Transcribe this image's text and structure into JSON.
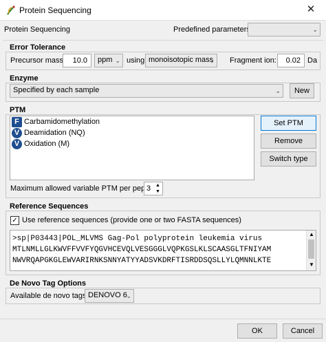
{
  "window": {
    "title": "Protein Sequencing",
    "close_glyph": "✕"
  },
  "header": {
    "label": "Protein Sequencing",
    "predefined_label": "Predefined parameters",
    "predefined_value": ""
  },
  "error_tolerance": {
    "title": "Error Tolerance",
    "precursor_label": "Precursor mass:",
    "precursor_value": "10.0",
    "unit_value": "ppm",
    "using_label": "using",
    "mass_type_value": "monoisotopic mass",
    "fragment_label": "Fragment ion:",
    "fragment_value": "0.02",
    "fragment_unit": "Da"
  },
  "enzyme": {
    "title": "Enzyme",
    "value": "Specified by each sample",
    "new_button": "New"
  },
  "ptm": {
    "title": "PTM",
    "items": [
      {
        "icon": "F",
        "label": "Carbamidomethylation",
        "kind": "fixed"
      },
      {
        "icon": "V",
        "label": "Deamidation (NQ)",
        "kind": "variable"
      },
      {
        "icon": "V",
        "label": "Oxidation (M)",
        "kind": "variable"
      }
    ],
    "set_button": "Set PTM",
    "remove_button": "Remove",
    "switch_button": "Switch type",
    "max_label": "Maximum allowed variable PTM per peptide",
    "max_value": "3"
  },
  "reference": {
    "title": "Reference Sequences",
    "use_checked": true,
    "use_label": "Use reference sequences (provide one or two FASTA sequences)",
    "lines": [
      ">sp|P03443|POL_MLVMS Gag-Pol polyprotein leukemia virus",
      "MTLNMLLGLKWVFFVVFYQGVHCEVQLVESGGGLVQPKGSLKLSCAASGLTFNIYAM",
      "NWVRQAPGKGLEWVARIRNKSNNYATYYADSVKDRFTISRDDSQSLLYLQMNNLKTE"
    ]
  },
  "denovo": {
    "title": "De Novo Tag Options",
    "available_label": "Available de novo tags:",
    "value": "DENOVO 6"
  },
  "footer": {
    "ok": "OK",
    "cancel": "Cancel"
  },
  "colors": {
    "accent": "#0078d7",
    "ptm_icon": "#1f4d8f"
  }
}
